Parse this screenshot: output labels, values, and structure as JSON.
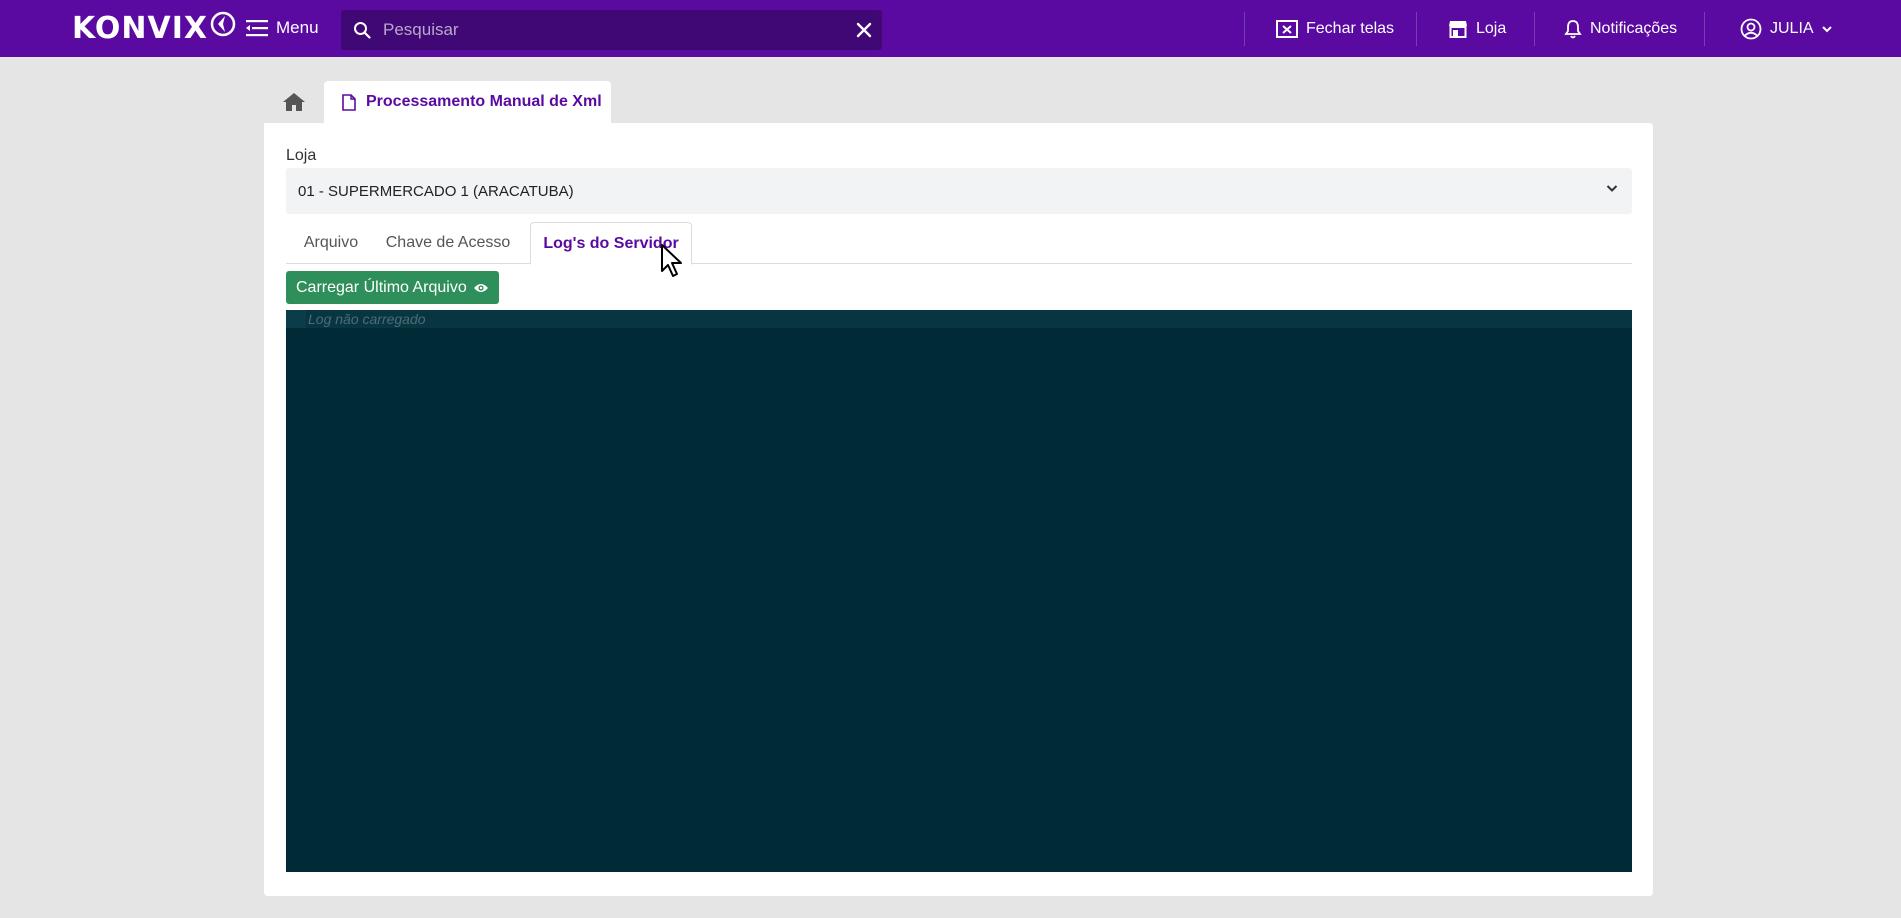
{
  "app": {
    "brand": "KONVIX",
    "menu_label": "Menu",
    "search_placeholder": "Pesquisar"
  },
  "topbar": {
    "close_screens": "Fechar telas",
    "store": "Loja",
    "notifications": "Notificações",
    "user": "JULIA"
  },
  "breadcrumb": {
    "page_title": "Processamento Manual de Xml"
  },
  "form": {
    "store_label": "Loja",
    "store_value": "01 - SUPERMERCADO 1 (ARACATUBA)"
  },
  "tabs": [
    {
      "label": "Arquivo",
      "active": false
    },
    {
      "label": "Chave de Acesso",
      "active": false
    },
    {
      "label": "Log's do Servidor",
      "active": true
    }
  ],
  "actions": {
    "load_last_file": "Carregar Último Arquivo"
  },
  "log": {
    "placeholder": "Log não carregado"
  },
  "colors": {
    "brand": "#5a0aa0",
    "button_green": "#2f8f5b",
    "log_bg": "#002b36"
  }
}
